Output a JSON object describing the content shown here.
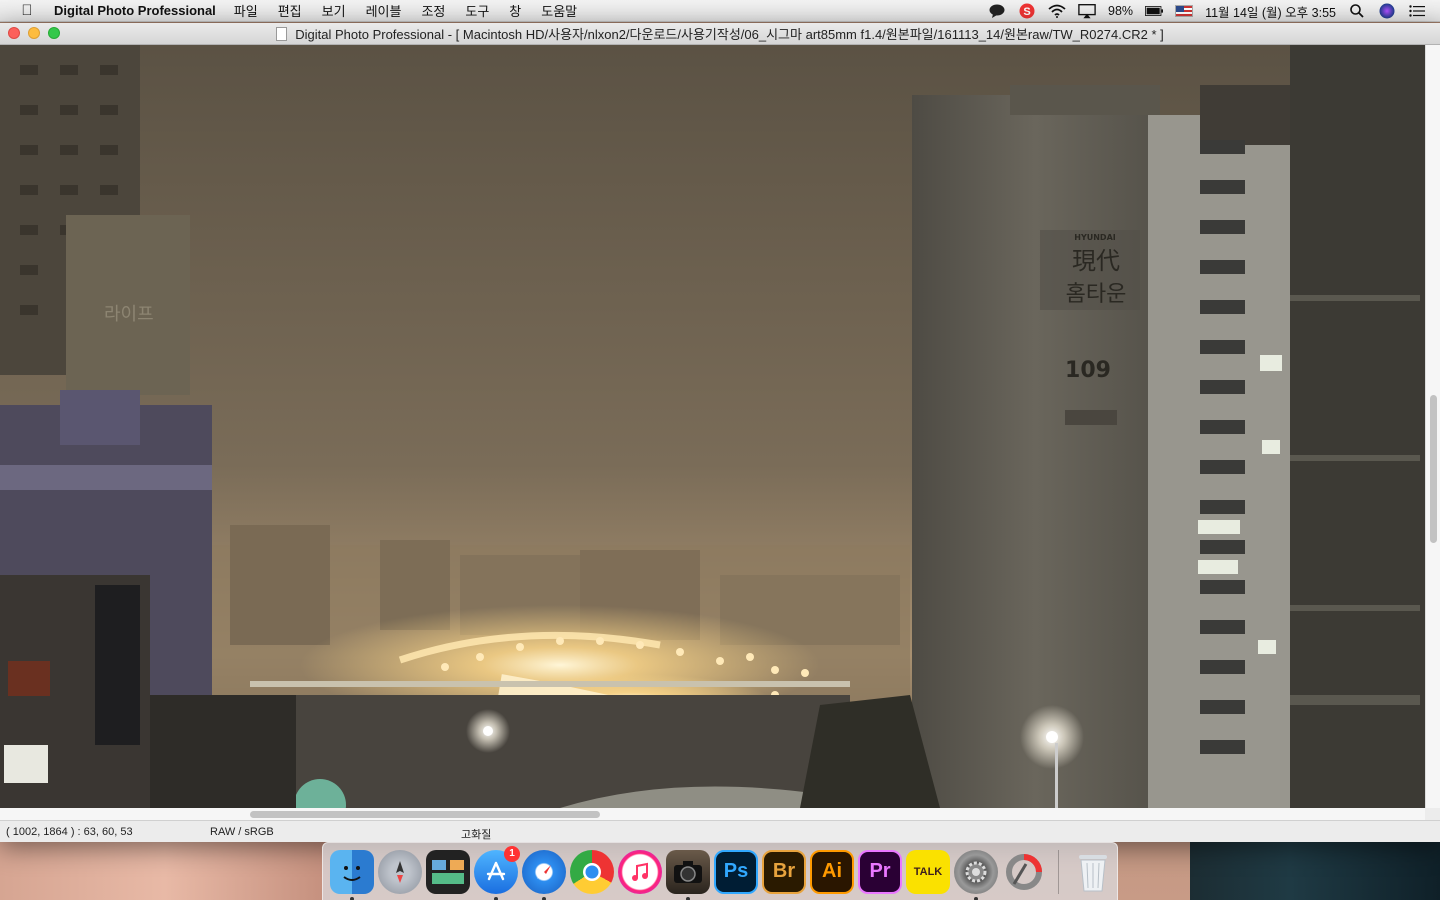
{
  "menubar": {
    "app_name": "Digital Photo Professional",
    "items": [
      "파일",
      "편집",
      "보기",
      "레이블",
      "조정",
      "도구",
      "창",
      "도움말"
    ],
    "battery": "98%",
    "clock": "11월 14일 (월) 오후 3:55"
  },
  "window": {
    "title": "Digital Photo Professional - [ Macintosh HD/사용자/nlxon2/다운로드/사용기작성/06_시그마 art85mm f1.4/원본파일/161113_14/원본raw/TW_R0274.CR2 * ]"
  },
  "photo": {
    "sign_brand": "HYUNDAI",
    "sign_hanja": "現代",
    "sign_korean": "홈타운",
    "building_number": "109",
    "left_sign": "라이프"
  },
  "statusbar": {
    "pixel_info": "( 1002, 1864 ) :  63,  60,  53",
    "color_mode": "RAW / sRGB",
    "quality": "고화질"
  },
  "dock": {
    "items": [
      {
        "name": "finder",
        "label": ""
      },
      {
        "name": "launchpad",
        "label": ""
      },
      {
        "name": "mission-control",
        "label": ""
      },
      {
        "name": "app-store",
        "label": "",
        "badge": "1"
      },
      {
        "name": "safari",
        "label": ""
      },
      {
        "name": "chrome",
        "label": ""
      },
      {
        "name": "itunes",
        "label": ""
      },
      {
        "name": "dpp",
        "label": ""
      },
      {
        "name": "photoshop",
        "label": "Ps"
      },
      {
        "name": "bridge",
        "label": "Br"
      },
      {
        "name": "illustrator",
        "label": "Ai"
      },
      {
        "name": "premiere",
        "label": "Pr"
      },
      {
        "name": "kakaotalk",
        "label": "TALK"
      },
      {
        "name": "system-preferences",
        "label": ""
      },
      {
        "name": "recorder",
        "label": ""
      },
      {
        "name": "trash",
        "label": ""
      }
    ]
  },
  "colors": {
    "close": "#fc605b",
    "minimize": "#fdbc40",
    "maximize": "#34c84a",
    "photoshop": "#001d34",
    "bridge": "#2a1a00",
    "illustrator": "#2a1600",
    "premiere": "#2a0034"
  }
}
